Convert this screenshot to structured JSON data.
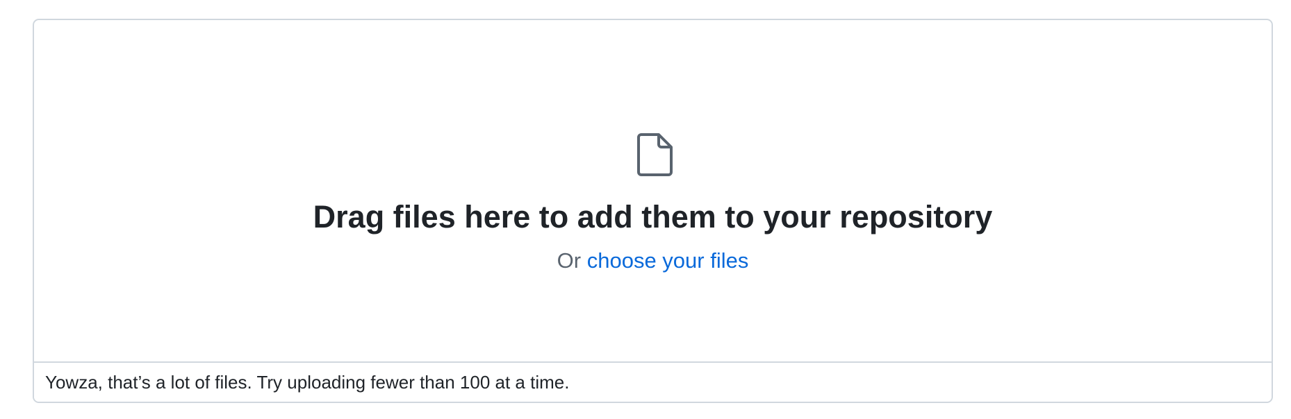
{
  "upload": {
    "icon": "file-icon",
    "title": "Drag files here to add them to your repository",
    "or_text": "Or",
    "choose_link_label": "choose your files",
    "error_message": "Yowza, that’s a lot of files. Try uploading fewer than 100 at a time."
  },
  "colors": {
    "border": "#d0d7de",
    "title_text": "#1f2328",
    "muted_text": "#59636e",
    "link": "#0969da",
    "icon_stroke": "#59636e"
  }
}
